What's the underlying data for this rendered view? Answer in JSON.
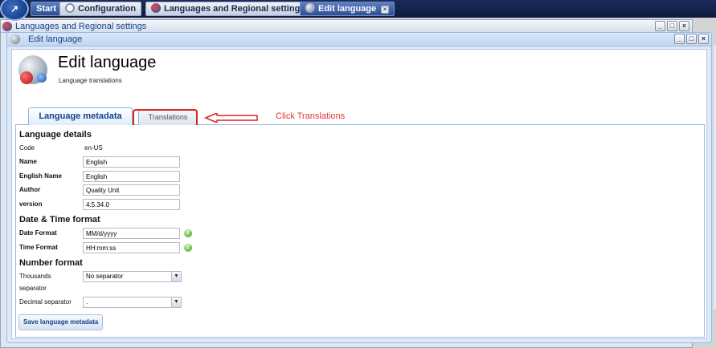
{
  "taskbar": {
    "start_label": "Start",
    "items": [
      {
        "label": "Configuration",
        "icon": "search-icon"
      },
      {
        "label": "Languages and Regional settings",
        "icon": "globe-icon"
      },
      {
        "label": "Edit language",
        "icon": "edit-language-icon"
      }
    ]
  },
  "background_window": {
    "title": "Languages and Regional settings"
  },
  "window": {
    "title": "Edit language",
    "controls": [
      "_",
      "□",
      "×"
    ]
  },
  "header": {
    "title": "Edit language",
    "subtitle": "Language translations"
  },
  "tabs": [
    {
      "label": "Language metadata",
      "active": true
    },
    {
      "label": "Translations",
      "active": false
    }
  ],
  "annotation": {
    "callout": "Click Translations",
    "color": "#d92525"
  },
  "form": {
    "language_details": {
      "heading": "Language details",
      "code_label": "Code",
      "code_value": "en-US",
      "name_label": "Name",
      "name_value": "English",
      "english_name_label": "English Name",
      "english_name_value": "English",
      "author_label": "Author",
      "author_value": "Quality Unit",
      "version_label": "version",
      "version_value": "4.5.34.0"
    },
    "date_time": {
      "heading": "Date & Time format",
      "date_label": "Date Format",
      "date_value": "MM/d/yyyy",
      "time_label": "Time Format",
      "time_value": "HH:mm:ss",
      "help_glyph": "?"
    },
    "number_format": {
      "heading": "Number format",
      "thousands_label_1": "Thousands",
      "thousands_label_2": "separator",
      "thousands_value": "No separator",
      "decimal_label": "Decimal separator",
      "decimal_value": "."
    },
    "save_label": "Save language metadata"
  },
  "colors": {
    "accent": "#15428b",
    "border": "#99bbe8",
    "taskbar": "#1a2c5a"
  }
}
